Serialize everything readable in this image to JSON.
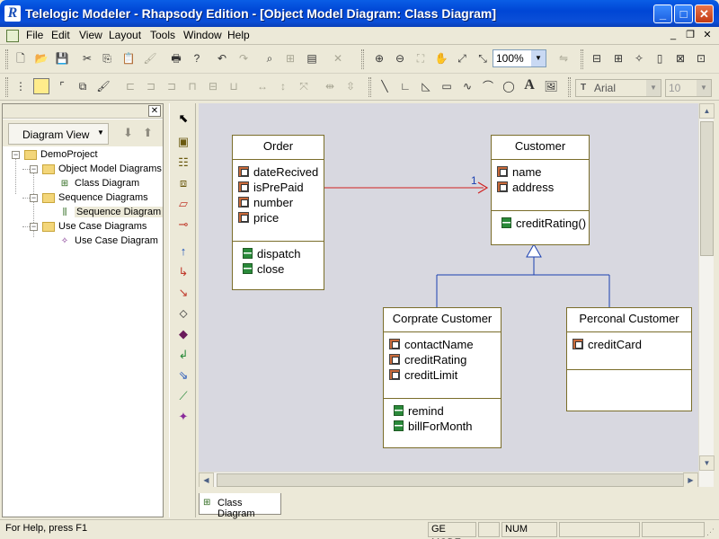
{
  "window": {
    "title": "Telelogic Modeler - Rhapsody Edition - [Object Model Diagram: Class Diagram]",
    "app_icon_glyph": "R",
    "min_glyph": "_",
    "max_glyph": "□",
    "close_glyph": "✕"
  },
  "menu": {
    "items": [
      "File",
      "Edit",
      "View",
      "Layout",
      "Tools",
      "Window",
      "Help"
    ]
  },
  "mdi_controls": {
    "min": "_",
    "restore": "❐",
    "close": "✕"
  },
  "toolbar": {
    "zoom": "100%",
    "font": "Arial",
    "font_size": "10"
  },
  "browser": {
    "close_glyph": "✕",
    "view_selector": "Diagram View",
    "tree": [
      {
        "label": "DemoProject",
        "kind": "project"
      },
      {
        "label": "Object Model Diagrams",
        "kind": "folder"
      },
      {
        "label": "Class Diagram",
        "kind": "diagram"
      },
      {
        "label": "Sequence Diagrams",
        "kind": "folder"
      },
      {
        "label": "Sequence Diagram",
        "kind": "diagram",
        "selected": true
      },
      {
        "label": "Use Case Diagrams",
        "kind": "folder"
      },
      {
        "label": "Use Case Diagram",
        "kind": "diagram"
      }
    ]
  },
  "diagram": {
    "classes": {
      "order": {
        "name": "Order",
        "attributes": [
          "dateRecived",
          "isPrePaid",
          "number",
          "price"
        ],
        "operations": [
          "dispatch",
          "close"
        ]
      },
      "customer": {
        "name": "Customer",
        "attributes": [
          "name",
          "address"
        ],
        "operations": [
          "creditRating()"
        ]
      },
      "corporate": {
        "name": "Corprate Customer",
        "attributes": [
          "contactName",
          "creditRating",
          "creditLimit"
        ],
        "operations": [
          "remind",
          "billForMonth"
        ]
      },
      "personal": {
        "name": "Perconal Customer",
        "attributes": [
          "creditCard"
        ],
        "operations": []
      }
    },
    "association_multiplicity": "1"
  },
  "tabs": {
    "active": "Class Diagram"
  },
  "status": {
    "message": "For Help, press F1",
    "mode": "GE MODE",
    "num": "NUM"
  }
}
